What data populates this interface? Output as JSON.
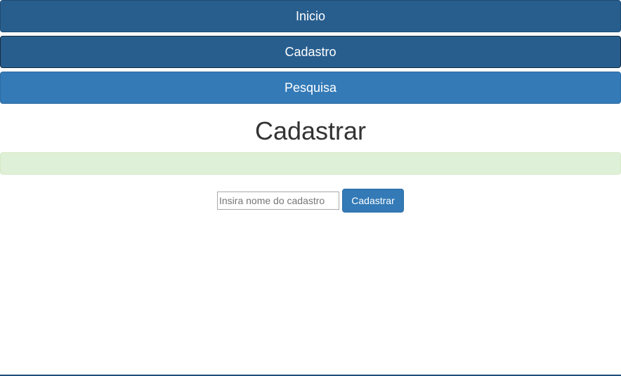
{
  "nav": {
    "items": [
      {
        "label": "Inicio"
      },
      {
        "label": "Cadastro"
      },
      {
        "label": "Pesquisa"
      }
    ]
  },
  "main": {
    "title": "Cadastrar",
    "alert_text": "",
    "form": {
      "name_placeholder": "Insira nome do cadastro",
      "name_value": "",
      "submit_label": "Cadastrar"
    }
  },
  "colors": {
    "nav_dark": "#285e8e",
    "nav_light": "#337ab7",
    "alert_bg": "#dff0d8",
    "button": "#337ab7"
  }
}
